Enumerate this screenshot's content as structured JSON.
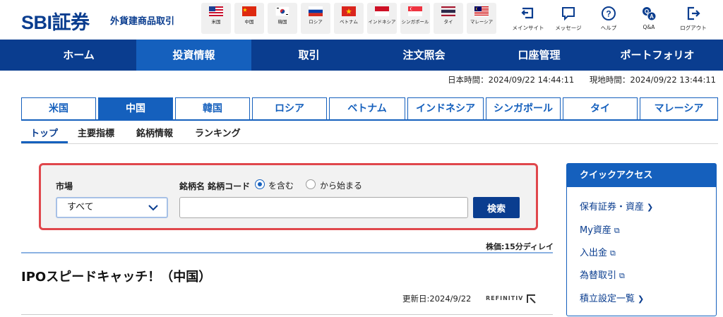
{
  "header": {
    "logo": "SBI証券",
    "subtitle": "外貨建商品取引",
    "countries": [
      {
        "label": "米国",
        "icon": "us-flag-icon"
      },
      {
        "label": "中国",
        "icon": "china-flag-icon"
      },
      {
        "label": "韓国",
        "icon": "korea-flag-icon"
      },
      {
        "label": "ロシア",
        "icon": "russia-flag-icon"
      },
      {
        "label": "ベトナム",
        "icon": "vietnam-flag-icon"
      },
      {
        "label": "インドネシア",
        "icon": "indonesia-flag-icon"
      },
      {
        "label": "シンガポール",
        "icon": "singapore-flag-icon"
      },
      {
        "label": "タイ",
        "icon": "thailand-flag-icon"
      },
      {
        "label": "マレーシア",
        "icon": "malaysia-flag-icon"
      }
    ],
    "utilities": [
      {
        "label": "メインサイト",
        "icon": "main-site-icon"
      },
      {
        "label": "メッセージ",
        "icon": "message-icon"
      },
      {
        "label": "ヘルプ",
        "icon": "help-icon"
      },
      {
        "label": "Q&A",
        "icon": "qa-icon"
      },
      {
        "label": "ログアウト",
        "icon": "logout-icon"
      }
    ]
  },
  "nav": {
    "items": [
      "ホーム",
      "投資情報",
      "取引",
      "注文照会",
      "口座管理",
      "ポートフォリオ"
    ],
    "active": "投資情報"
  },
  "times": {
    "japan": "日本時間：2024/09/22 14:44:11",
    "local": "現地時間：2024/09/22 13:44:11"
  },
  "country_tabs": {
    "items": [
      "米国",
      "中国",
      "韓国",
      "ロシア",
      "ベトナム",
      "インドネシア",
      "シンガポール",
      "タイ",
      "マレーシア"
    ],
    "active": "中国"
  },
  "sub_tabs": {
    "items": [
      "トップ",
      "主要指標",
      "銘柄情報",
      "ランキング"
    ],
    "active": "トップ"
  },
  "search": {
    "market_label": "市場",
    "market_value": "すべて",
    "name_label": "銘柄名 銘柄コード",
    "radio_contains": "を含む",
    "radio_starts": "から始まる",
    "selected": "contains",
    "input_value": "",
    "button": "検索"
  },
  "delay_note": "株価:15分ディレイ",
  "ipo": {
    "title": "IPOスピードキャッチ！（中国）",
    "updated": "更新日:2024/9/22",
    "source": "REFINITIV"
  },
  "quick_access": {
    "title": "クイックアクセス",
    "items": [
      {
        "label": "保有証券・資産",
        "icon": "chevron-right-icon"
      },
      {
        "label": "My資産",
        "icon": "external-link-icon"
      },
      {
        "label": "入出金",
        "icon": "external-link-icon"
      },
      {
        "label": "為替取引",
        "icon": "external-link-icon"
      },
      {
        "label": "積立設定一覧",
        "icon": "chevron-right-icon"
      }
    ]
  },
  "colors": {
    "brand": "#0a3d8f",
    "accent": "#1560bd",
    "highlight_border": "#e0474c"
  }
}
